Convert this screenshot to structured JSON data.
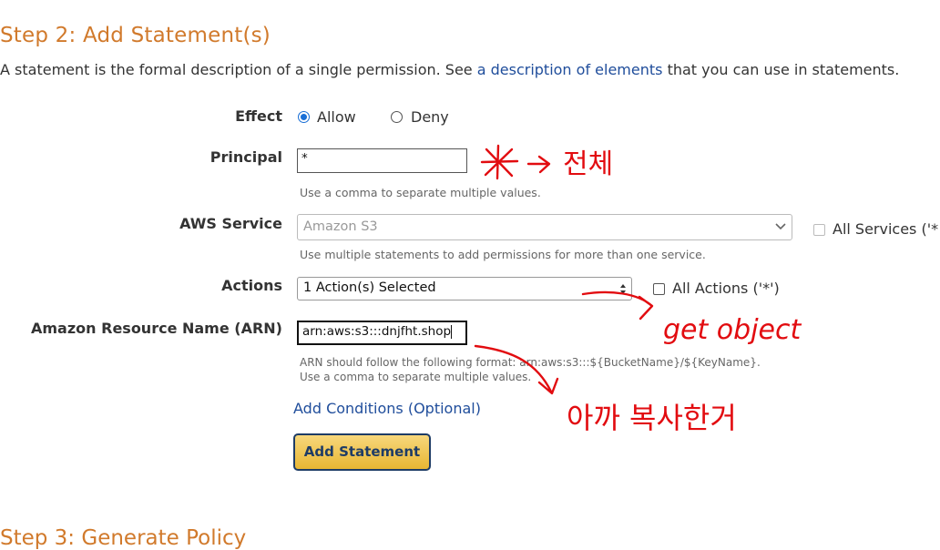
{
  "step": {
    "title": "Step 2: Add Statement(s)",
    "intro_before": "A statement is the formal description of a single permission. See ",
    "intro_link": "a description of elements",
    "intro_after": " that you can use in statements."
  },
  "effect": {
    "label": "Effect",
    "options": [
      "Allow",
      "Deny"
    ],
    "selected": "Allow"
  },
  "principal": {
    "label": "Principal",
    "value": "*",
    "help": "Use a comma to separate multiple values."
  },
  "service": {
    "label": "AWS Service",
    "selected": "Amazon S3",
    "help": "Use multiple statements to add permissions for more than one service.",
    "all_label": "All Services ('*"
  },
  "actions": {
    "label": "Actions",
    "selected": "1 Action(s) Selected",
    "all_label": "All Actions ('*')"
  },
  "arn": {
    "label": "Amazon Resource Name (ARN)",
    "value": "arn:aws:s3:::dnjfht.shop",
    "help1": "ARN should follow the following format: arn:aws:s3:::${BucketName}/${KeyName}.",
    "help2": "Use a comma to separate multiple values."
  },
  "add_conditions": "Add Conditions (Optional)",
  "add_statement_button": "Add Statement",
  "next_step_title": "Step 3: Generate Policy",
  "annotations": {
    "principal_note": "전체",
    "actions_note": "get object",
    "arn_note": "아까 복사한거",
    "ink_color": "#e20c10"
  }
}
